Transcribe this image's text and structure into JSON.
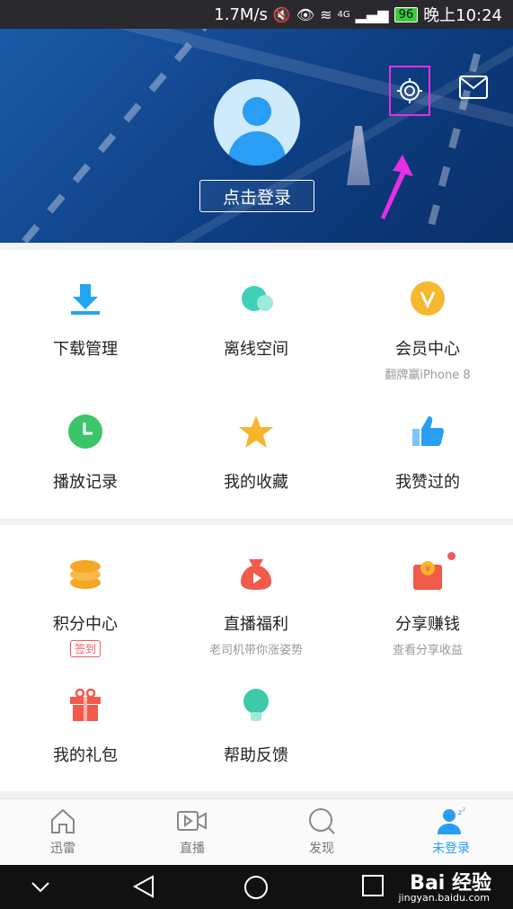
{
  "status_bar": {
    "speed": "1.7M/s",
    "network": "4G",
    "battery": "96",
    "time": "晚上10:24"
  },
  "header": {
    "login_label": "点击登录",
    "settings_icon": "gear-icon",
    "mail_icon": "mail-icon"
  },
  "grid1": [
    {
      "label": "下载管理",
      "sub": "",
      "icon": "download-icon",
      "color": "#23a6f0"
    },
    {
      "label": "离线空间",
      "sub": "",
      "icon": "cloud-icon",
      "color": "#3fd0b8"
    },
    {
      "label": "会员中心",
      "sub": "翻牌赢iPhone 8",
      "icon": "vip-icon",
      "color": "#f5b82e"
    },
    {
      "label": "播放记录",
      "sub": "",
      "icon": "clock-icon",
      "color": "#3cc46a"
    },
    {
      "label": "我的收藏",
      "sub": "",
      "icon": "star-icon",
      "color": "#f7b52c"
    },
    {
      "label": "我赞过的",
      "sub": "",
      "icon": "thumbs-up-icon",
      "color": "#2a9df4"
    }
  ],
  "grid2": [
    {
      "label": "积分中心",
      "badge": "签到",
      "sub": "",
      "icon": "coins-icon",
      "color": "#f5a623"
    },
    {
      "label": "直播福利",
      "sub": "老司机带你涨姿势",
      "icon": "money-bag-icon",
      "color": "#f25a4a"
    },
    {
      "label": "分享赚钱",
      "sub": "查看分享收益",
      "icon": "red-envelope-icon",
      "color": "#f25a4a"
    },
    {
      "label": "我的礼包",
      "sub": "",
      "icon": "gift-icon",
      "color": "#f25a4a"
    },
    {
      "label": "帮助反馈",
      "sub": "",
      "icon": "lightbulb-icon",
      "color": "#3fcaa9"
    }
  ],
  "tabs": [
    {
      "label": "迅雷",
      "icon": "home-icon",
      "active": false
    },
    {
      "label": "直播",
      "icon": "video-icon",
      "active": false
    },
    {
      "label": "发现",
      "icon": "search-icon",
      "active": false
    },
    {
      "label": "未登录",
      "icon": "user-sleep-icon",
      "active": true
    }
  ],
  "watermark": {
    "brand": "Bai 经验",
    "url": "jingyan.baidu.com"
  }
}
